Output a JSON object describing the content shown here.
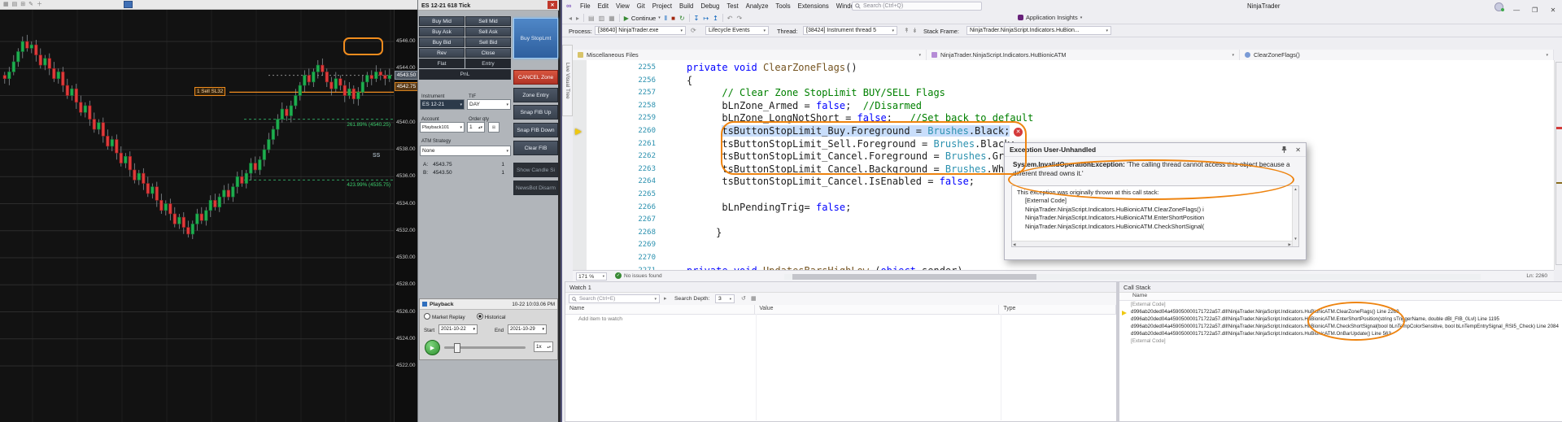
{
  "nt": {
    "window": {
      "dom_header": "ES 12-21 618 Tick",
      "close_glyph": "✕"
    },
    "chart": {
      "grid_prices": [
        4546,
        4544,
        4542,
        4540,
        4538,
        4536,
        4534,
        4532,
        4530,
        4528,
        4526,
        4524,
        4522
      ],
      "axis": [
        {
          "p": 4546,
          "t": "4546.00"
        },
        {
          "p": 4544,
          "t": "4544.00"
        },
        {
          "p": 4540,
          "t": "4540.00"
        },
        {
          "p": 4538,
          "t": "4538.00"
        },
        {
          "p": 4536,
          "t": "4536.00"
        },
        {
          "p": 4534,
          "t": "4534.00"
        },
        {
          "p": 4532,
          "t": "4532.00"
        },
        {
          "p": 4530,
          "t": "4530.00"
        },
        {
          "p": 4528,
          "t": "4528.00"
        },
        {
          "p": 4526,
          "t": "4526.00"
        },
        {
          "p": 4524,
          "t": "4524.00"
        },
        {
          "p": 4522,
          "t": "4522.00"
        }
      ],
      "last_price": {
        "p": 4543.5,
        "t": "4543.50"
      },
      "sell_price": {
        "p": 4542.75,
        "t": "4542.75"
      },
      "fibs": [
        {
          "t": "261.89% (4540.25)",
          "p": 4540.25
        },
        {
          "t": "423.99% (4535.75)",
          "p": 4535.75
        }
      ],
      "ss_label": "SS",
      "ss_p": 4537.5,
      "sell_tag": {
        "t": "1 Sell SL32",
        "p": 4542.25
      },
      "closes": [
        4543.25,
        4543.75,
        4544.5,
        4545.25,
        4546.0,
        4545.5,
        4545.75,
        4545.0,
        4544.25,
        4544.75,
        4544.0,
        4543.25,
        4543.75,
        4542.75,
        4542.0,
        4542.5,
        4541.5,
        4540.75,
        4541.25,
        4540.25,
        4539.5,
        4540.0,
        4539.0,
        4538.25,
        4538.75,
        4537.75,
        4537.0,
        4537.5,
        4536.5,
        4535.75,
        4536.25,
        4535.5,
        4534.75,
        4535.25,
        4534.25,
        4533.5,
        4534.0,
        4533.25,
        4532.5,
        4533.0,
        4532.25,
        4531.75,
        4532.5,
        4533.25,
        4532.75,
        4533.5,
        4534.25,
        4533.75,
        4534.5,
        4535.0,
        4534.5,
        4535.25,
        4536.0,
        4535.5,
        4536.25,
        4537.0,
        4536.5,
        4537.25,
        4538.0,
        4538.75,
        4539.5,
        4540.25,
        4541.0,
        4540.5,
        4541.25,
        4542.0,
        4542.75,
        4543.5,
        4543.0,
        4543.75,
        4544.25,
        4543.75,
        4543.0,
        4542.5,
        4543.25,
        4542.75,
        4542.0,
        4542.5,
        4541.75,
        4542.25,
        4543.0,
        4543.5,
        4543.25,
        4543.75,
        4543.5,
        4543.25,
        4543.5
      ]
    },
    "dom": {
      "pairs": [
        [
          "Buy Mid",
          "Sell Mid"
        ],
        [
          "Buy Ask",
          "Sell Ask"
        ],
        [
          "Buy Bid",
          "Sell Bid"
        ],
        [
          "Rev",
          "Close"
        ],
        [
          "Flat",
          "Entry"
        ]
      ],
      "pnl": "PnL",
      "right": [
        {
          "t": "Buy StopLmt",
          "s": "active"
        },
        {
          "t": "CANCEL Zone",
          "s": "red"
        },
        {
          "t": "Zone Entry",
          "s": "norm"
        },
        {
          "t": "Snap FIB Up",
          "s": "norm"
        },
        {
          "t": "Snap FIB Down",
          "s": "norm"
        },
        {
          "t": "Clear FIB",
          "s": "norm"
        },
        {
          "t": "Show Candle Si",
          "s": "dim"
        },
        {
          "t": "NewsBot Disarm",
          "s": "dim"
        }
      ],
      "form": {
        "instrument_label": "Instrument",
        "instrument": "ES 12-21",
        "tif_label": "TIF",
        "tif": "DAY",
        "account_label": "Account",
        "account": "Playback101",
        "qty_label": "Order qty",
        "qty": "1",
        "atm_label": "ATM Strategy",
        "atm": "None"
      },
      "quotes": [
        {
          "l": "A:",
          "p": "4543.75",
          "q": "1"
        },
        {
          "l": "B:",
          "p": "4543.50",
          "q": "1"
        }
      ]
    },
    "playback": {
      "title": "Playback",
      "time": "10-22 10:03.06 PM",
      "replay": "Market Replay",
      "historical": "Historical",
      "start_label": "Start",
      "start": "2021-10-22",
      "end_label": "End",
      "end": "2021-10-29",
      "speed": "1x"
    }
  },
  "vs": {
    "menu": [
      "File",
      "Edit",
      "View",
      "Git",
      "Project",
      "Build",
      "Debug",
      "Test",
      "Analyze",
      "Tools",
      "Extensions",
      "Window",
      "Help"
    ],
    "search_placeholder": "Search (Ctrl+Q)",
    "window_title": "NinjaTrader",
    "toolbar": {
      "continue_label": "Continue",
      "app_insights": "Application Insights"
    },
    "debugbar": {
      "process_label": "Process:",
      "process": "[38640] NinjaTrader.exe",
      "lifecycle": "Lifecycle Events",
      "thread_label": "Thread:",
      "thread": "[38424] Instrument thread 5",
      "frame_label": "Stack Frame:",
      "frame": "NinjaTrader.NinjaScript.Indicators.HuBion..."
    },
    "navbar": {
      "project": "Miscellaneous Files",
      "type": "NinjaTrader.NinjaScript.Indicators.HuBionicATM",
      "member": "ClearZoneFlags()"
    },
    "editor": {
      "zoom": "171 %",
      "health": "No issues found",
      "ln": "Ln: 2260",
      "lines": [
        {
          "n": 2255,
          "ind": 0,
          "tokens": [
            [
              "kw",
              "private"
            ],
            [
              "pl",
              " "
            ],
            [
              "kw",
              "void"
            ],
            [
              "pl",
              " "
            ],
            [
              "mth",
              "ClearZoneFlags"
            ],
            [
              "pl",
              "()"
            ]
          ]
        },
        {
          "n": 2256,
          "ind": 0,
          "tokens": [
            [
              "pl",
              "{"
            ]
          ]
        },
        {
          "n": 2257,
          "ind": 6,
          "tokens": [
            [
              "cm",
              "// Clear Zone StopLimit BUY/SELL Flags"
            ]
          ]
        },
        {
          "n": 2258,
          "ind": 6,
          "tokens": [
            [
              "id",
              "bLnZone_Armed"
            ],
            [
              "pl",
              " = "
            ],
            [
              "kw",
              "false"
            ],
            [
              "pl",
              ";  "
            ],
            [
              "cm",
              "//Disarmed"
            ]
          ]
        },
        {
          "n": 2259,
          "ind": 6,
          "tokens": [
            [
              "id",
              "bLnZone_LongNotShort"
            ],
            [
              "pl",
              " = "
            ],
            [
              "kw",
              "false"
            ],
            [
              "pl",
              ";   "
            ],
            [
              "cm",
              "//Set back to default"
            ]
          ]
        },
        {
          "n": 2260,
          "ind": 6,
          "sel": true,
          "tokens": [
            [
              "id",
              "tsButtonStopLimit_Buy"
            ],
            [
              "pl",
              ".Foreground = "
            ],
            [
              "ty",
              "Brushes"
            ],
            [
              "pl",
              ".Black;"
            ]
          ]
        },
        {
          "n": 2261,
          "ind": 6,
          "tokens": [
            [
              "id",
              "tsButtonStopLimit_Sell"
            ],
            [
              "pl",
              ".Foreground = "
            ],
            [
              "ty",
              "Brushes"
            ],
            [
              "pl",
              ".Black;"
            ]
          ]
        },
        {
          "n": 2262,
          "ind": 6,
          "tokens": [
            [
              "id",
              "tsButtonStopLimit_Cancel"
            ],
            [
              "pl",
              ".Foreground = "
            ],
            [
              "ty",
              "Brushes"
            ],
            [
              "pl",
              ".Gray;"
            ]
          ]
        },
        {
          "n": 2263,
          "ind": 6,
          "tokens": [
            [
              "id",
              "tsButtonStopLimit_Cancel"
            ],
            [
              "pl",
              ".Background = "
            ],
            [
              "ty",
              "Brushes"
            ],
            [
              "pl",
              ".White;"
            ]
          ]
        },
        {
          "n": 2264,
          "ind": 6,
          "tokens": [
            [
              "id",
              "tsButtonStopLimit_Cancel"
            ],
            [
              "pl",
              ".IsEnabled = "
            ],
            [
              "kw",
              "false"
            ],
            [
              "pl",
              ";"
            ]
          ]
        },
        {
          "n": 2265,
          "ind": 0,
          "tokens": []
        },
        {
          "n": 2266,
          "ind": 6,
          "tokens": [
            [
              "id",
              "bLnPendingTrig"
            ],
            [
              "pl",
              "= "
            ],
            [
              "kw",
              "false"
            ],
            [
              "pl",
              ";"
            ]
          ]
        },
        {
          "n": 2267,
          "ind": 0,
          "tokens": []
        },
        {
          "n": 2268,
          "ind": 5,
          "tokens": [
            [
              "pl",
              "}"
            ]
          ]
        },
        {
          "n": 2269,
          "ind": 0,
          "tokens": []
        },
        {
          "n": 2270,
          "ind": 0,
          "tokens": []
        },
        {
          "n": 2271,
          "ind": 0,
          "tokens": [
            [
              "kw",
              "private"
            ],
            [
              "pl",
              " "
            ],
            [
              "kw",
              "void"
            ],
            [
              "pl",
              " "
            ],
            [
              "mth",
              "UpdatesBarsHighLow"
            ],
            [
              "pl",
              " ("
            ],
            [
              "kw",
              "object"
            ],
            [
              "pl",
              " sender)"
            ]
          ]
        }
      ]
    },
    "exception": {
      "title": "Exception User-Unhandled",
      "type": "System.InvalidOperationException:",
      "message": "'The calling thread cannot access this object because a different thread owns it.'",
      "stack_intro": "This exception was originally thrown at this call stack:",
      "stack": [
        "[External Code]",
        "NinjaTrader.NinjaScript.Indicators.HuBionicATM.ClearZoneFlags() i",
        "NinjaTrader.NinjaScript.Indicators.HuBionicATM.EnterShortPosition",
        "NinjaTrader.NinjaScript.Indicators.HuBionicATM.CheckShortSignal("
      ]
    },
    "watch": {
      "title": "Watch 1",
      "search_placeholder": "Search (Ctrl+E)",
      "depth_label": "Search Depth:",
      "depth": "3",
      "columns": [
        "Name",
        "Value",
        "Type"
      ],
      "empty": "Add item to watch"
    },
    "callstack": {
      "title": "Call Stack",
      "column": "Name",
      "rows": [
        {
          "t": "[External Code]",
          "gray": true
        },
        {
          "t": "d996ab20ded04a459050000171722a57.dll!NinjaTrader.NinjaScript.Indicators.HuBionicATM.ClearZoneFlags() Line 2260",
          "current": true
        },
        {
          "t": "d996ab20ded04a459050000171722a57.dll!NinjaTrader.NinjaScript.Indicators.HuBionicATM.EnterShortPosition(string sTriggerName, double dBl_FIB_0Lvl) Line 1195"
        },
        {
          "t": "d996ab20ded04a459050000171722a57.dll!NinjaTrader.NinjaScript.Indicators.HuBionicATM.CheckShortSignal(bool bLnTempColorSensitive, bool bLnTempEntrySignal_RSI5_Check) Line 2084"
        },
        {
          "t": "d996ab20ded04a459050000171722a57.dll!NinjaTrader.NinjaScript.Indicators.HuBionicATM.OnBarUpdate() Line 563"
        },
        {
          "t": "[External Code]",
          "gray": true
        }
      ]
    }
  }
}
